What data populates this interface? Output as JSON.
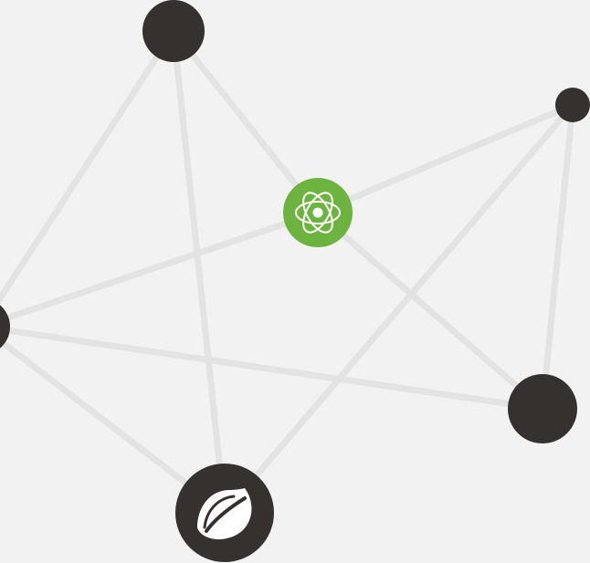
{
  "colors": {
    "background": "#f2f2f2",
    "edge": "#e3e3e3",
    "node_dark": "#35312e",
    "node_accent": "#6db33f",
    "icon_light": "#ffffff"
  },
  "nodes": [
    {
      "id": "top-node",
      "kind": "plain",
      "color": "#35312e"
    },
    {
      "id": "top-right-node",
      "kind": "plain",
      "color": "#35312e"
    },
    {
      "id": "atom-node",
      "kind": "atom-icon",
      "color": "#6db33f"
    },
    {
      "id": "left-node",
      "kind": "plain",
      "color": "#35312e"
    },
    {
      "id": "right-node",
      "kind": "plain",
      "color": "#35312e"
    },
    {
      "id": "spring-node",
      "kind": "spring-leaf-icon",
      "color": "#35312e"
    }
  ],
  "edges": [
    {
      "from": "top-node",
      "to": "left-node"
    },
    {
      "from": "top-node",
      "to": "atom-node"
    },
    {
      "from": "top-node",
      "to": "spring-node"
    },
    {
      "from": "left-node",
      "to": "atom-node"
    },
    {
      "from": "left-node",
      "to": "right-node"
    },
    {
      "from": "left-node",
      "to": "spring-node"
    },
    {
      "from": "atom-node",
      "to": "top-right-node"
    },
    {
      "from": "atom-node",
      "to": "right-node"
    },
    {
      "from": "top-right-node",
      "to": "spring-node"
    },
    {
      "from": "top-right-node",
      "to": "right-node"
    }
  ]
}
